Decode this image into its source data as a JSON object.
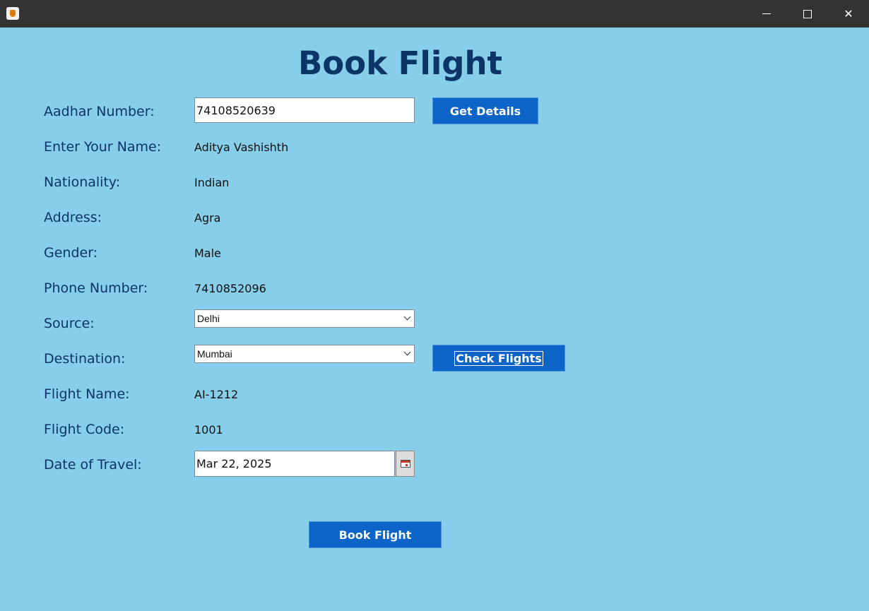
{
  "window": {
    "title": "",
    "controls": {
      "minimize": "minimize-icon",
      "maximize": "maximize-icon",
      "close": "close-icon"
    }
  },
  "page": {
    "heading": "Book Flight"
  },
  "form": {
    "aadhar": {
      "label": "Aadhar Number:",
      "value": "74108520639"
    },
    "get_details_label": "Get Details",
    "name": {
      "label": "Enter Your Name:",
      "value": "Aditya Vashishth"
    },
    "nationality": {
      "label": "Nationality:",
      "value": "Indian"
    },
    "address": {
      "label": "Address:",
      "value": "Agra"
    },
    "gender": {
      "label": "Gender:",
      "value": "Male"
    },
    "phone": {
      "label": "Phone Number:",
      "value": "7410852096"
    },
    "source": {
      "label": "Source:",
      "selected": "Delhi"
    },
    "destination": {
      "label": "Destination:",
      "selected": "Mumbai"
    },
    "check_flights_label": "Check Flights",
    "flight_name": {
      "label": "Flight Name:",
      "value": "AI-1212"
    },
    "flight_code": {
      "label": "Flight Code:",
      "value": "1001"
    },
    "date_of_travel": {
      "label": "Date of Travel:",
      "value": "Mar 22, 2025"
    },
    "book_flight_label": "Book Flight"
  },
  "colors": {
    "background": "#87ceea",
    "heading": "#0a3566",
    "button": "#0c64c8",
    "titlebar": "#333333"
  }
}
